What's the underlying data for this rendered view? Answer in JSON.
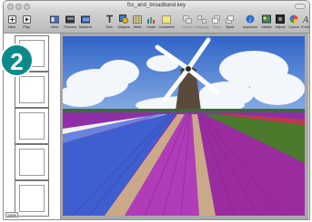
{
  "window": {
    "title": "fcc_and_broadband.key"
  },
  "toolbar": {
    "items": [
      {
        "label": "New",
        "icon": "new-slide-icon"
      },
      {
        "label": "Play",
        "icon": "play-icon"
      },
      {
        "label": "View",
        "icon": "view-icon"
      },
      {
        "label": "Themes",
        "icon": "themes-icon"
      },
      {
        "label": "Masters",
        "icon": "masters-icon"
      },
      {
        "label": "Text",
        "icon": "text-icon"
      },
      {
        "label": "Shapes",
        "icon": "shapes-icon"
      },
      {
        "label": "Table",
        "icon": "table-icon"
      },
      {
        "label": "Chart",
        "icon": "chart-icon"
      },
      {
        "label": "Comment",
        "icon": "comment-icon"
      },
      {
        "label": "Group",
        "icon": "group-icon"
      },
      {
        "label": "Ungroup",
        "icon": "ungroup-icon"
      },
      {
        "label": "Front",
        "icon": "front-icon"
      },
      {
        "label": "Back",
        "icon": "back-icon"
      },
      {
        "label": "Inspector",
        "icon": "inspector-icon"
      },
      {
        "label": "Media",
        "icon": "media-icon"
      },
      {
        "label": "Adjust",
        "icon": "adjust-icon"
      },
      {
        "label": "Colors",
        "icon": "colors-icon"
      },
      {
        "label": "Fonts",
        "icon": "fonts-icon"
      }
    ]
  },
  "sidebar": {
    "zoom": "100%"
  },
  "callout": {
    "number": "2"
  },
  "colors": {
    "badge": "#0c8a8a",
    "sky": "#5e8fd6",
    "field_purple": "#8e2fa8",
    "field_blue": "#3f5fd0"
  }
}
